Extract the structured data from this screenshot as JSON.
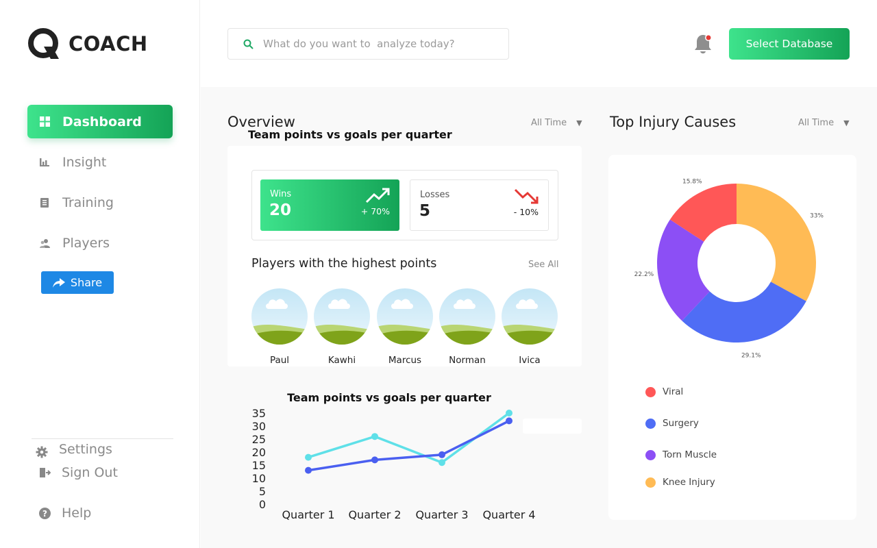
{
  "brand": {
    "name": "COACH"
  },
  "nav": {
    "items": [
      {
        "label": "Dashboard",
        "icon": "grid-icon",
        "active": true
      },
      {
        "label": "Insight",
        "icon": "bar-chart-icon",
        "active": false
      },
      {
        "label": "Training",
        "icon": "document-icon",
        "active": false
      },
      {
        "label": "Players",
        "icon": "users-icon",
        "active": false
      }
    ],
    "share_label": "Share",
    "settings_label": "Settings",
    "signout_label": "Sign Out",
    "help_label": "Help"
  },
  "header": {
    "search_placeholder": "What do you want to  analyze today?",
    "notification_icon": "bell-icon",
    "select_db_label": "Select Database"
  },
  "overview": {
    "title": "Overview",
    "filter": "All Time",
    "subtitle": "Team points  vs goals per quarter",
    "wins": {
      "label": "Wins",
      "value": "20",
      "change": "+ 70%"
    },
    "losses": {
      "label": "Losses",
      "value": "5",
      "change": "- 10%"
    },
    "players_title": "Players with  the highest points",
    "see_all": "See All",
    "players": [
      "Paul",
      "Kawhi",
      "Marcus",
      "Norman",
      "Ivica"
    ]
  },
  "injury": {
    "title": "Top Injury Causes",
    "filter": "All Time"
  },
  "colors": {
    "accent_green": "#1fbf6e",
    "primary_blue": "#1e88e5",
    "viral": "#ff5757",
    "surgery": "#4f6df5",
    "torn_muscle": "#8c4ff5",
    "knee_injury": "#ffbb55",
    "line_cyan": "#5fe0e8",
    "line_blue": "#4a5ff0"
  },
  "chart_data": [
    {
      "type": "line",
      "title": "Team points  vs goals per quarter",
      "categories": [
        "Quarter 1",
        "Quarter 2",
        "Quarter 3",
        "Quarter 4"
      ],
      "yticks": [
        "35",
        "30",
        "25",
        "20",
        "15",
        "10",
        "5",
        "0"
      ],
      "ylim": [
        0,
        35
      ],
      "series": [
        {
          "values": [
            18,
            26,
            16,
            35
          ]
        },
        {
          "values": [
            13,
            17,
            19,
            32
          ]
        }
      ]
    },
    {
      "type": "pie",
      "title": "Top Injury Causes",
      "slices": [
        {
          "name": "Knee Injury",
          "value": 33.0,
          "label": "33%"
        },
        {
          "name": "Surgery",
          "value": 29.1,
          "label": "29.1%"
        },
        {
          "name": "Torn Muscle",
          "value": 22.2,
          "label": "22.2%"
        },
        {
          "name": "Viral",
          "value": 15.8,
          "label": "15.8%"
        }
      ],
      "legend": [
        "Viral",
        "Surgery",
        "Torn Muscle",
        "Knee Injury"
      ]
    }
  ]
}
